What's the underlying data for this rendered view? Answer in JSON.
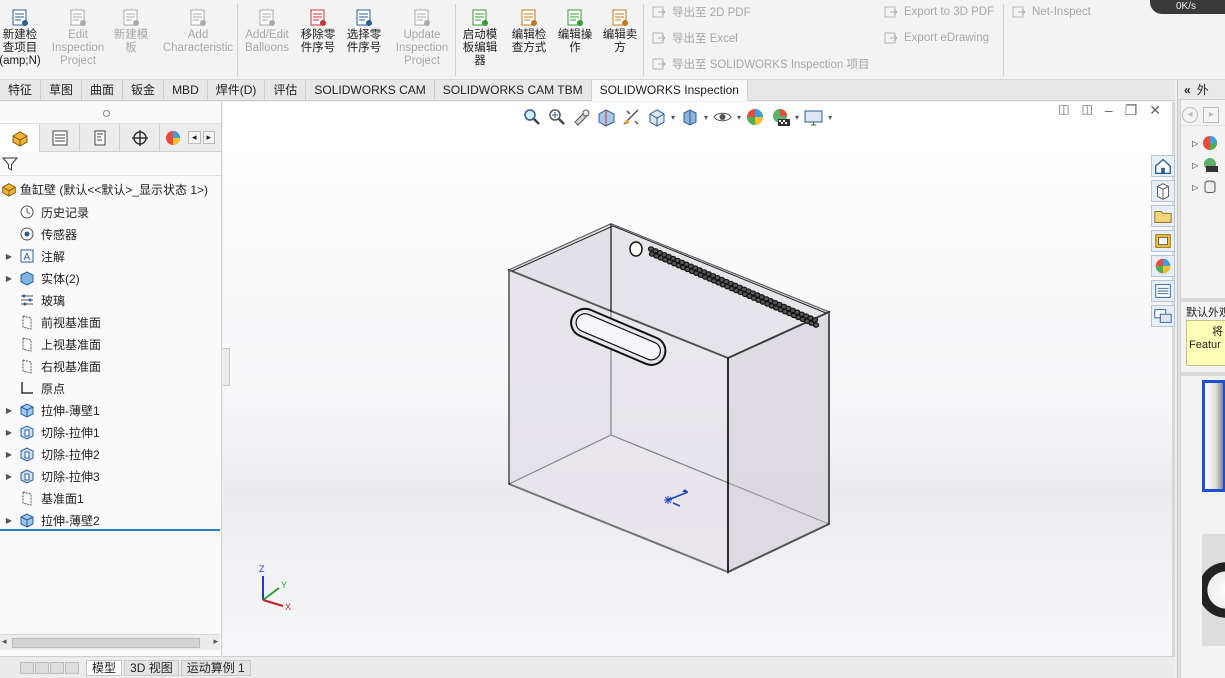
{
  "ribbon": {
    "buttons": [
      {
        "label": "新建检查项目(amp;N)",
        "lines": [
          "新建检",
          "查项目",
          "(amp;N)"
        ],
        "enabled": true
      },
      {
        "label": "Edit Inspection Project",
        "lines": [
          "Edit",
          "Inspection",
          "Project"
        ],
        "enabled": false
      },
      {
        "label": "新建模板",
        "lines": [
          "新建模",
          "板"
        ],
        "enabled": false
      },
      {
        "label": "Add Characteristic",
        "lines": [
          "Add",
          "Characteristic"
        ],
        "enabled": false
      },
      {
        "label": "Add/Edit Balloons",
        "lines": [
          "Add/Edit",
          "Balloons"
        ],
        "enabled": false
      },
      {
        "label": "移除零件序号",
        "lines": [
          "移除零",
          "件序号"
        ],
        "enabled": true
      },
      {
        "label": "选择零件序号",
        "lines": [
          "选择零",
          "件序号"
        ],
        "enabled": true
      },
      {
        "label": "Update Inspection Project",
        "lines": [
          "Update",
          "Inspection",
          "Project"
        ],
        "enabled": false
      },
      {
        "label": "启动模板编辑器",
        "lines": [
          "启动模",
          "板编辑",
          "器"
        ],
        "enabled": true
      },
      {
        "label": "编辑检查方式",
        "lines": [
          "编辑检",
          "查方式"
        ],
        "enabled": true
      },
      {
        "label": "编辑操作",
        "lines": [
          "编辑操",
          "作"
        ],
        "enabled": true
      },
      {
        "label": "编辑卖方",
        "lines": [
          "编辑卖",
          "方"
        ],
        "enabled": true
      }
    ],
    "export_rows": {
      "col1": [
        "导出至 2D PDF",
        "导出至 Excel",
        "导出至 SOLIDWORKS Inspection 项目"
      ],
      "col2": [
        "Export to 3D PDF",
        "Export eDrawing"
      ],
      "col3": [
        "Net-Inspect"
      ]
    },
    "speed": "0K/s"
  },
  "tabs": [
    "特征",
    "草图",
    "曲面",
    "钣金",
    "MBD",
    "焊件(D)",
    "评估",
    "SOLIDWORKS CAM",
    "SOLIDWORKS CAM TBM",
    "SOLIDWORKS Inspection"
  ],
  "active_tab": "SOLIDWORKS Inspection",
  "tree": {
    "root": "鱼缸壁 (默认<<默认>_显示状态 1>)",
    "items": [
      {
        "label": "历史记录",
        "expandable": false,
        "icon": "history-icon"
      },
      {
        "label": "传感器",
        "expandable": false,
        "icon": "sensor-icon"
      },
      {
        "label": "注解",
        "expandable": true,
        "icon": "annotation-icon"
      },
      {
        "label": "实体(2)",
        "expandable": true,
        "icon": "solid-bodies-icon"
      },
      {
        "label": "玻璃",
        "expandable": false,
        "icon": "material-icon"
      },
      {
        "label": "前视基准面",
        "expandable": false,
        "icon": "plane-icon"
      },
      {
        "label": "上视基准面",
        "expandable": false,
        "icon": "plane-icon"
      },
      {
        "label": "右视基准面",
        "expandable": false,
        "icon": "plane-icon"
      },
      {
        "label": "原点",
        "expandable": false,
        "icon": "origin-icon"
      },
      {
        "label": "拉伸-薄壁1",
        "expandable": true,
        "icon": "extrude-icon"
      },
      {
        "label": "切除-拉伸1",
        "expandable": true,
        "icon": "cut-extrude-icon"
      },
      {
        "label": "切除-拉伸2",
        "expandable": true,
        "icon": "cut-extrude-icon"
      },
      {
        "label": "切除-拉伸3",
        "expandable": true,
        "icon": "cut-extrude-icon"
      },
      {
        "label": "基准面1",
        "expandable": false,
        "icon": "plane-icon"
      },
      {
        "label": "拉伸-薄壁2",
        "expandable": true,
        "icon": "extrude-icon"
      }
    ]
  },
  "triad": {
    "z": "Z",
    "y": "Y",
    "x": "X"
  },
  "right_pane": {
    "appearance_label": "默认外观",
    "tooltip_line1": "将",
    "tooltip_line2": "Featur",
    "header": "外"
  },
  "bottom_tabs": [
    "模型",
    "3D 视图",
    "运动算例 1"
  ],
  "colors": {
    "accent": "#2f7cc0",
    "ribbon_bg": "#f3f3f3",
    "disabled": "#a8a8a8"
  }
}
